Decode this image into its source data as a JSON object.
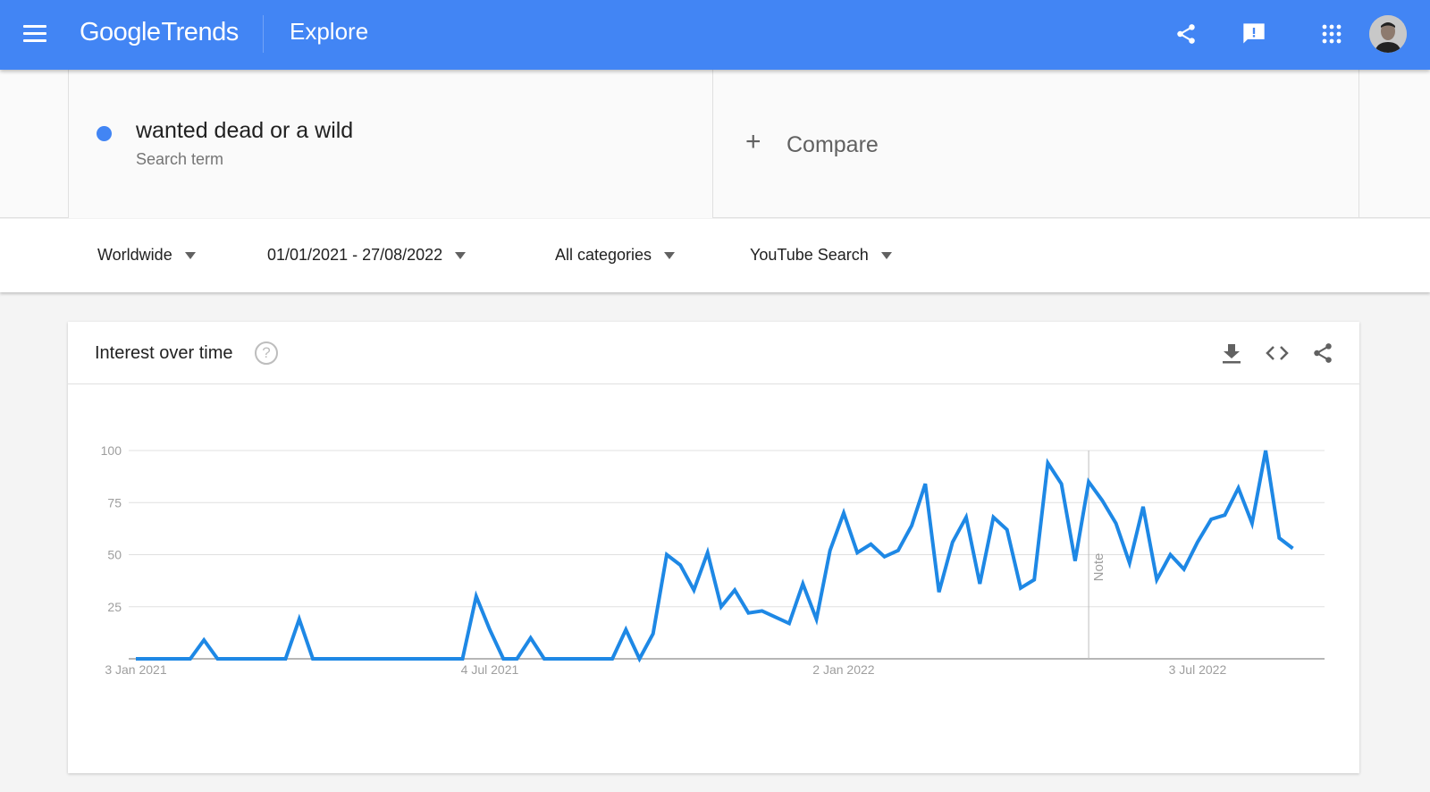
{
  "header": {
    "logo_google": "Google",
    "logo_trends": "Trends",
    "section": "Explore",
    "icons": [
      "menu-icon",
      "share-icon",
      "feedback-icon",
      "apps-icon",
      "avatar"
    ],
    "brand_color": "#4285f4"
  },
  "search": {
    "term": "wanted dead or a wild",
    "term_type": "Search term",
    "term_color": "#4285f4",
    "compare_label": "Compare",
    "compare_icon": "+"
  },
  "filters": {
    "location": "Worldwide",
    "date_range": "01/01/2021 - 27/08/2022",
    "category": "All categories",
    "property": "YouTube Search"
  },
  "card": {
    "title": "Interest over time",
    "help_icon": "?",
    "actions": [
      "download-icon",
      "embed-icon",
      "share-icon"
    ]
  },
  "chart_data": {
    "type": "line",
    "title": "Interest over time",
    "xlabel": "",
    "ylabel": "",
    "ylim": [
      0,
      100
    ],
    "yticks": [
      25,
      50,
      75,
      100
    ],
    "xtick_labels": [
      "3 Jan 2021",
      "4 Jul 2021",
      "2 Jan 2022",
      "3 Jul 2022"
    ],
    "xtick_weeks": [
      0,
      26,
      52,
      78
    ],
    "x_start": "3 Jan 2021",
    "x_interval": "weekly",
    "grid": true,
    "annotation": {
      "label": "Note",
      "week": 70
    },
    "series": [
      {
        "name": "wanted dead or a wild",
        "color": "#1e88e5",
        "values": [
          0,
          0,
          0,
          0,
          0,
          9,
          0,
          0,
          0,
          0,
          0,
          0,
          19,
          0,
          0,
          0,
          0,
          0,
          0,
          0,
          0,
          0,
          0,
          0,
          0,
          30,
          14,
          0,
          0,
          10,
          0,
          0,
          0,
          0,
          0,
          0,
          14,
          0,
          12,
          50,
          45,
          33,
          51,
          25,
          33,
          22,
          23,
          20,
          17,
          36,
          19,
          52,
          70,
          51,
          55,
          49,
          52,
          64,
          84,
          32,
          56,
          68,
          36,
          68,
          62,
          34,
          38,
          94,
          84,
          47,
          85,
          76,
          65,
          46,
          73,
          38,
          50,
          43,
          56,
          67,
          69,
          82,
          65,
          100,
          58,
          53
        ]
      }
    ]
  }
}
